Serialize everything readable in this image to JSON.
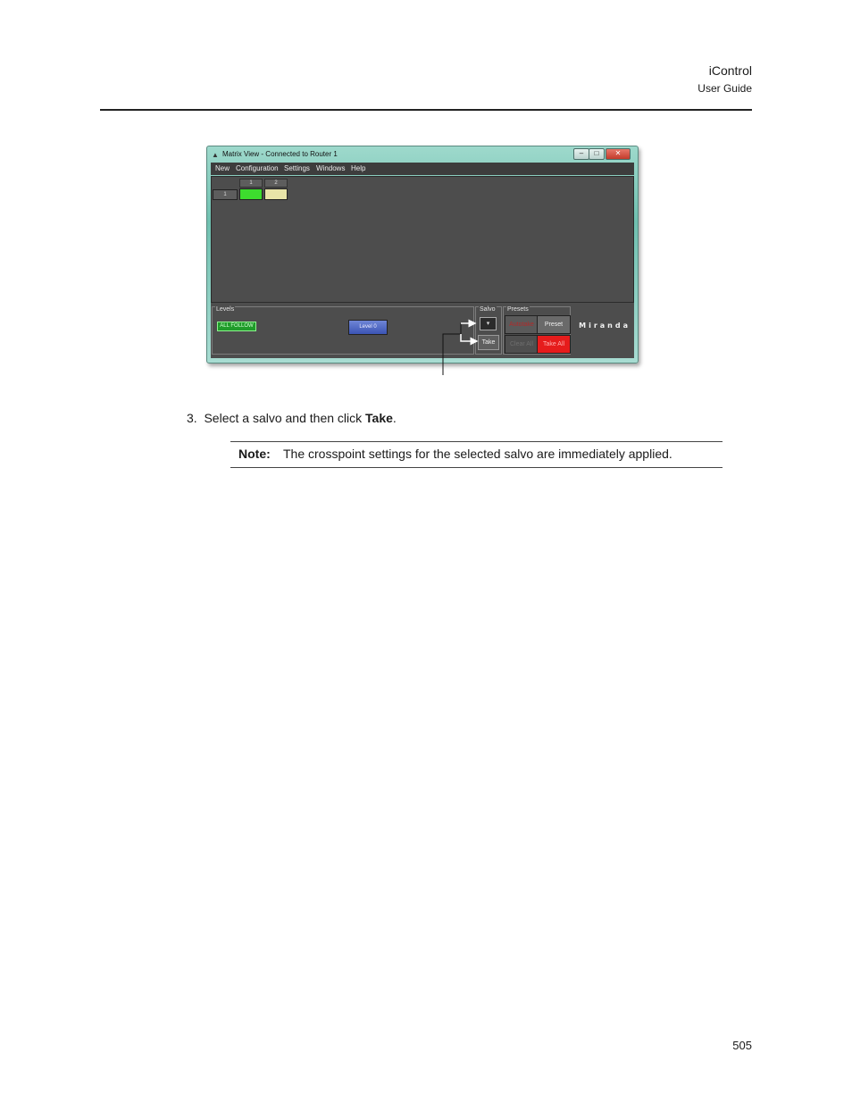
{
  "header": {
    "title": "iControl",
    "subtitle": "User Guide"
  },
  "window": {
    "title": "Matrix View - Connected to Router 1",
    "controls": [
      "–",
      "□",
      "✕"
    ],
    "menu": [
      "New",
      "Configuration",
      "Settings",
      "Windows",
      "Help"
    ],
    "matrix": {
      "column_headers": [
        "1",
        "2"
      ],
      "row_headers": [
        "1"
      ],
      "cell_colors": [
        "#3ddc2e",
        "#e8e4a8"
      ]
    },
    "levels": {
      "label": "Levels",
      "all_follow": "ALL FOLLOW",
      "level_button": "Level 0"
    },
    "salvo": {
      "label": "Salvo",
      "dropdown": "▾",
      "take": "Take"
    },
    "presets": {
      "label": "Presets",
      "buttons": [
        "Autotake",
        "Preset",
        "Clear All",
        "Take All"
      ]
    },
    "brand": "Miranda"
  },
  "step": {
    "number": "3.",
    "text_before": "Select a salvo and then click ",
    "bold": "Take",
    "text_after": "."
  },
  "note": {
    "label": "Note:",
    "text": "The crosspoint settings for the selected salvo are immediately applied."
  },
  "footer": {
    "page_number": "505"
  }
}
